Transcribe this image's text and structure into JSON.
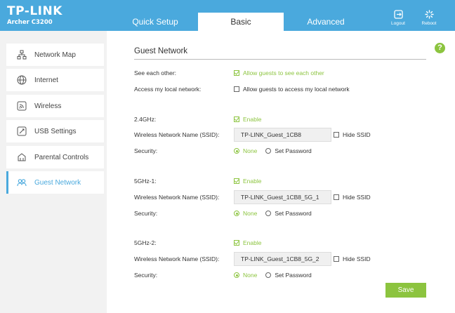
{
  "brand": {
    "name": "TP-LINK",
    "model": "Archer C3200"
  },
  "tabs": [
    {
      "label": "Quick Setup"
    },
    {
      "label": "Basic"
    },
    {
      "label": "Advanced"
    }
  ],
  "tools": {
    "logout": "Logout",
    "reboot": "Reboot"
  },
  "sidebar": {
    "items": [
      {
        "label": "Network Map",
        "icon": "network-map-icon"
      },
      {
        "label": "Internet",
        "icon": "globe-icon"
      },
      {
        "label": "Wireless",
        "icon": "wireless-icon"
      },
      {
        "label": "USB Settings",
        "icon": "usb-icon"
      },
      {
        "label": "Parental Controls",
        "icon": "parental-icon"
      },
      {
        "label": "Guest Network",
        "icon": "guest-icon"
      }
    ]
  },
  "help": "?",
  "main": {
    "title": "Guest Network",
    "see_each_other": {
      "label": "See each other:",
      "option": "Allow guests to see each other",
      "checked": true
    },
    "access_local": {
      "label": "Access my local network:",
      "option": "Allow guests to access my local network",
      "checked": false
    },
    "bands": [
      {
        "label": "2.4GHz:",
        "enable": "Enable",
        "ssid_label": "Wireless Network Name (SSID):",
        "ssid": "TP-LINK_Guest_1CB8",
        "hide_ssid": "Hide SSID",
        "security_label": "Security:",
        "opt_none": "None",
        "opt_password": "Set Password"
      },
      {
        "label": "5GHz-1:",
        "enable": "Enable",
        "ssid_label": "Wireless Network Name (SSID):",
        "ssid": "TP-LINK_Guest_1CB8_5G_1",
        "hide_ssid": "Hide SSID",
        "security_label": "Security:",
        "opt_none": "None",
        "opt_password": "Set Password"
      },
      {
        "label": "5GHz-2:",
        "enable": "Enable",
        "ssid_label": "Wireless Network Name (SSID):",
        "ssid": "TP-LINK_Guest_1CB8_5G_2",
        "hide_ssid": "Hide SSID",
        "security_label": "Security:",
        "opt_none": "None",
        "opt_password": "Set Password"
      }
    ],
    "save_label": "Save"
  },
  "colors": {
    "header": "#4aa9dd",
    "accent_green": "#8cc43f",
    "sidebar_bg": "#f2f2f2"
  }
}
